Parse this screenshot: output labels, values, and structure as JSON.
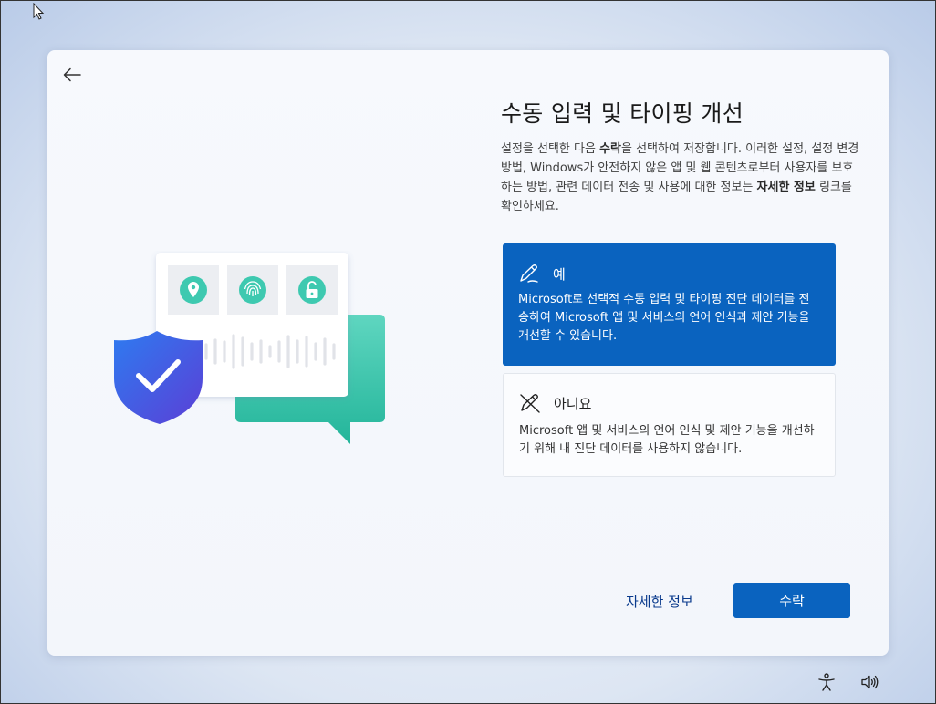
{
  "page": {
    "title": "수동 입력 및 타이핑 개선",
    "description_part1": "설정을 선택한 다음 ",
    "description_bold1": "수락",
    "description_part2": "을 선택하여 저장합니다. 이러한 설정, 설정 변경 방법, Windows가 안전하지 않은 앱 및 웹 콘텐츠로부터 사용자를 보호하는 방법, 관련 데이터 전송 및 사용에 대한 정보는 ",
    "description_bold2": "자세한 정보",
    "description_part3": " 링크를 확인하세요."
  },
  "options": [
    {
      "label": "예",
      "icon": "pen-icon",
      "selected": true,
      "description": "Microsoft로 선택적 수동 입력 및 타이핑 진단 데이터를 전송하여 Microsoft 앱 및 서비스의 언어 인식과 제안 기능을 개선할 수 있습니다."
    },
    {
      "label": "아니요",
      "icon": "pen-off-icon",
      "selected": false,
      "description": "Microsoft 앱 및 서비스의 언어 인식 및 제안 기능을 개선하기 위해 내 진단 데이터를 사용하지 않습니다."
    }
  ],
  "buttons": {
    "learn_more": "자세한 정보",
    "accept": "수락"
  },
  "colors": {
    "accent": "#0a63bf",
    "teal": "#3ec9b0",
    "shield": "#3b5fe0"
  }
}
